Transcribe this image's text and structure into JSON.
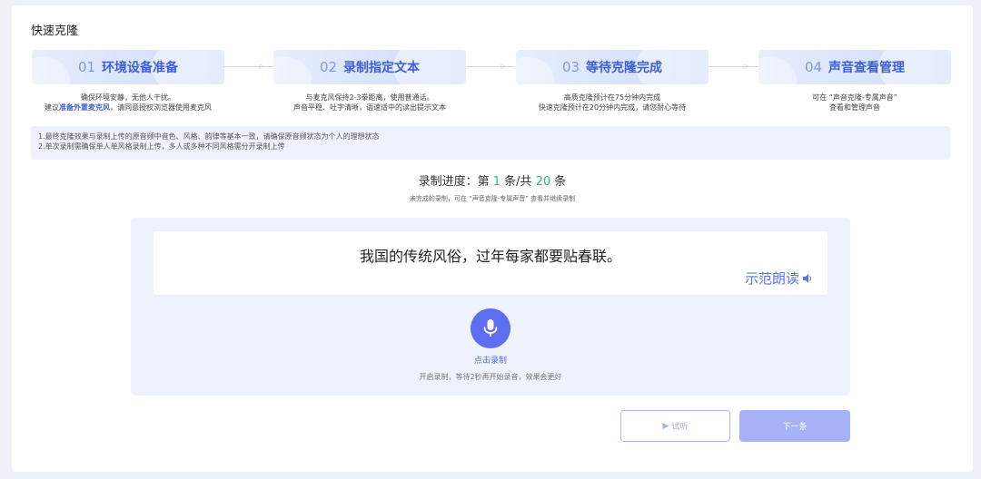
{
  "page": {
    "title": "快速克隆"
  },
  "steps": [
    {
      "num": "01",
      "name": "环境设备准备",
      "desc_line1": "确保环境安静，无他人干扰。",
      "desc_line2_pre": "建议",
      "desc_line2_hl": "准备外置麦克风",
      "desc_line2_post": "，请同意授权浏览器使用麦克风"
    },
    {
      "num": "02",
      "name": "录制指定文本",
      "desc_line1": "与麦克风保持2-3拳距离，使用普通话。",
      "desc_line2": "声音平稳、吐字清晰，语速适中的读出提示文本"
    },
    {
      "num": "03",
      "name": "等待克隆完成",
      "desc_line1": "高质克隆预计在75分钟内完成",
      "desc_line2": "快速克隆预计在20分钟内完成，请您耐心等待"
    },
    {
      "num": "04",
      "name": "声音查看管理",
      "desc_line1": "可在 “声音克隆-专属声音”",
      "desc_line2": "查看和管理声音"
    }
  ],
  "notice": {
    "line1": "1.最终克隆效果与录制上传的原音频中音色、风格、韵律等基本一致，请确保原音频状态为个人的理想状态",
    "line2": "2.单次录制需确保单人单风格录制上传，多人或多种不同风格需分开录制上传"
  },
  "progress": {
    "prefix": "录制进度：第",
    "current": "1",
    "middle": "条/共",
    "total": "20",
    "suffix": "条",
    "tip": "未完成的录制，可在 “声音克隆-专属声音” 查看并继续录制"
  },
  "record": {
    "sentence": "我国的传统风俗，过年每家都要贴春联。",
    "demo_label": "示范朗读",
    "mic_label": "点击录制",
    "mic_tip": "开启录制，等待2秒再开始录音，效果会更好"
  },
  "buttons": {
    "try_label": "试听",
    "next_label": "下一条"
  },
  "colors": {
    "accent": "#5d6ff0",
    "progress_num": "#21c27a",
    "step_title": "#3f5fd8"
  }
}
